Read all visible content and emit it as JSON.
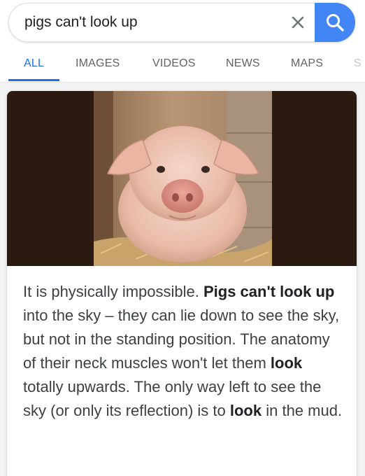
{
  "search": {
    "query": "pigs can't look up",
    "clear_icon": "close-icon",
    "search_icon": "magnifier-icon"
  },
  "tabs": [
    {
      "label": "ALL",
      "active": true
    },
    {
      "label": "IMAGES"
    },
    {
      "label": "VIDEOS"
    },
    {
      "label": "NEWS"
    },
    {
      "label": "MAPS"
    },
    {
      "label": "S"
    }
  ],
  "colors": {
    "accent": "#1a73e8",
    "search_button": "#4285f4",
    "image_band": "#2b1a10"
  },
  "result": {
    "image": "piglet-photo",
    "snippet": [
      {
        "text": "It is physically impossible. "
      },
      {
        "text": "Pigs can't look up",
        "bold": true
      },
      {
        "text": " into the sky – they can lie down to see the sky, but not in the standing position. The anatomy of their neck muscles won't let them "
      },
      {
        "text": "look",
        "bold": true
      },
      {
        "text": " totally upwards. The only way left to see the sky (or only its reflection) is to "
      },
      {
        "text": "look",
        "bold": true
      },
      {
        "text": " in the mud."
      }
    ]
  }
}
